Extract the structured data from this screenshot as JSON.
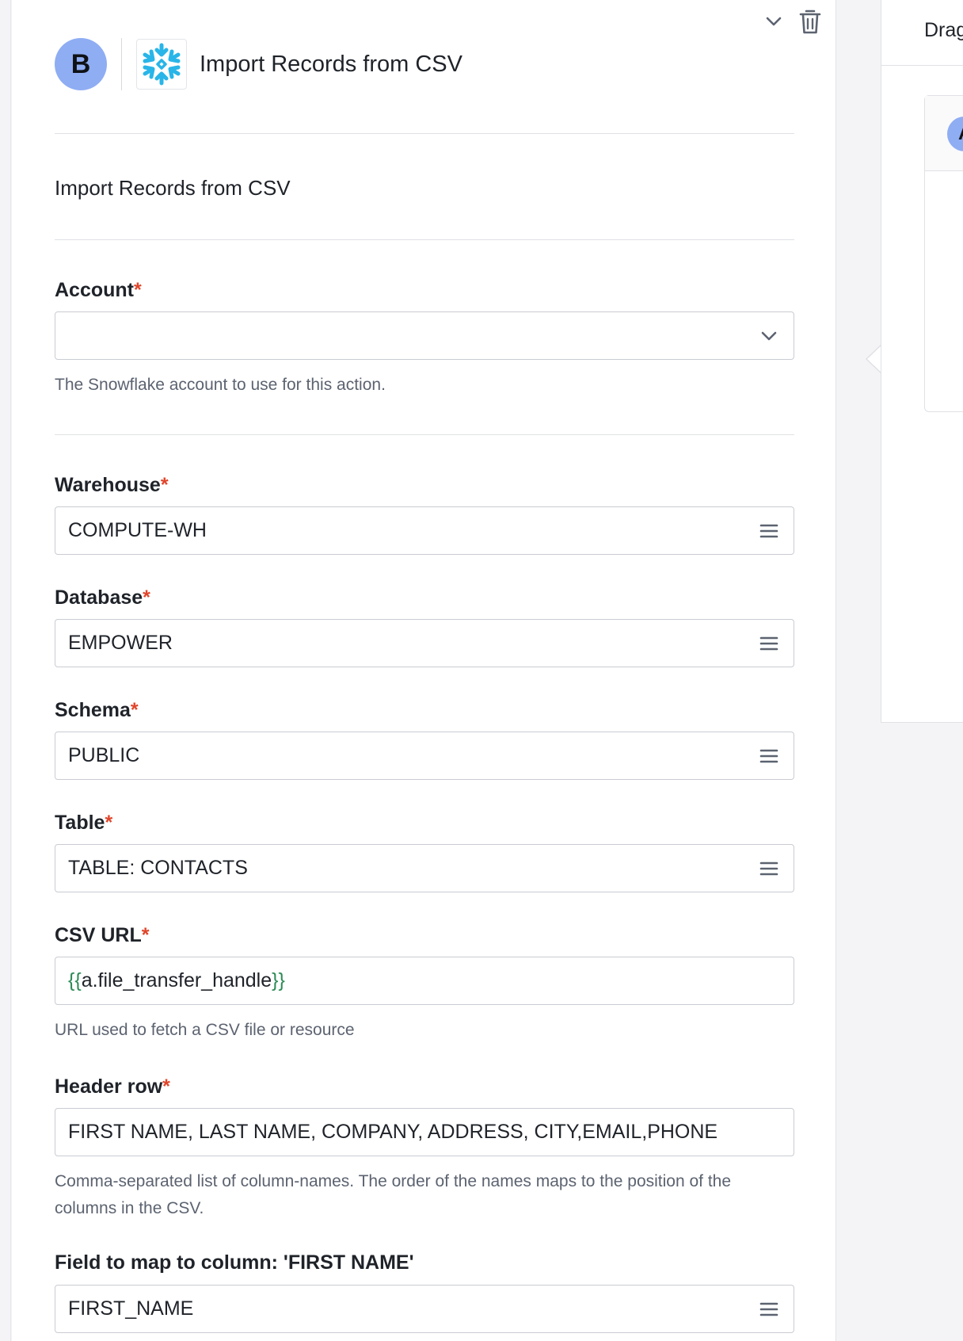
{
  "header": {
    "avatar_letter": "B",
    "app_icon": "snowflake-icon",
    "title": "Import Records from CSV"
  },
  "toolbar": {
    "collapse_icon": "chevron-down-icon",
    "delete_icon": "trash-icon"
  },
  "step_name": "Import Records from CSV",
  "fields": {
    "account": {
      "label": "Account",
      "required_mark": "*",
      "value": "",
      "help": "The Snowflake account to use for this action."
    },
    "warehouse": {
      "label": "Warehouse",
      "required_mark": "*",
      "value": "COMPUTE-WH"
    },
    "database": {
      "label": "Database",
      "required_mark": "*",
      "value": "EMPOWER"
    },
    "schema": {
      "label": "Schema",
      "required_mark": "*",
      "value": "PUBLIC"
    },
    "table": {
      "label": "Table",
      "required_mark": "*",
      "value": "TABLE: CONTACTS"
    },
    "csv_url": {
      "label": "CSV URL",
      "required_mark": "*",
      "value_open": "{{",
      "value_var": "a.file_transfer_handle",
      "value_close": "}}",
      "help": "URL used to fetch a CSV file or resource"
    },
    "header_row": {
      "label": "Header row",
      "required_mark": "*",
      "value": "FIRST NAME, LAST NAME, COMPANY, ADDRESS, CITY,EMAIL,PHONE",
      "help": "Comma-separated list of column-names. The order of the names maps to the position of the columns in the CSV."
    },
    "map_first_name": {
      "label": "Field to map to column: 'FIRST NAME'",
      "value": "FIRST_NAME"
    }
  },
  "side_panel": {
    "title": "Drag",
    "avatar_letter": "A"
  },
  "colors": {
    "avatar": "#8fadf3",
    "required": "#e0452b",
    "template_brace": "#2e8b57",
    "snowflake": "#29b5e8"
  }
}
